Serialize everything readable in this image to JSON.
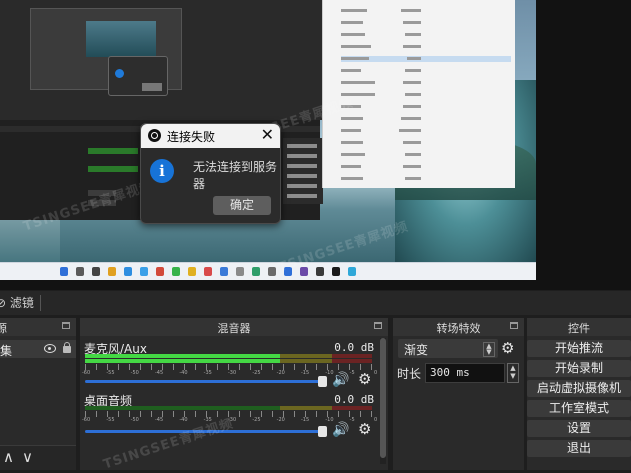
{
  "dialog": {
    "title": "连接失败",
    "message": "无法连接到服务器",
    "ok_label": "确定",
    "close_glyph": "✕"
  },
  "toolbar": {
    "filters_label": "⊘ 滤镜"
  },
  "sources": {
    "header_fragment": "源",
    "item_label": "集"
  },
  "mixer": {
    "title": "混音器",
    "channels": [
      {
        "name": "麦克风/Aux",
        "db": "0.0 dB",
        "level": 0.68
      },
      {
        "name": "桌面音频",
        "db": "0.0 dB",
        "level": 0.0
      }
    ],
    "ticks": [
      "-60",
      "-55",
      "-50",
      "-45",
      "-40",
      "-35",
      "-30",
      "-25",
      "-20",
      "-15",
      "-10",
      "-5",
      "0"
    ]
  },
  "transitions": {
    "title": "转场特效",
    "selected": "渐变",
    "duration_label": "时长",
    "duration_value": "300 ms"
  },
  "controls": {
    "title": "控件",
    "buttons": [
      "开始推流",
      "开始录制",
      "启动虚拟摄像机",
      "工作室模式",
      "设置",
      "退出"
    ]
  },
  "watermark": "TSINGSEE青犀视频",
  "colors": {
    "accent": "#2d6fd6",
    "meter_green": "#44d844",
    "dialog_info": "#1773d7"
  }
}
